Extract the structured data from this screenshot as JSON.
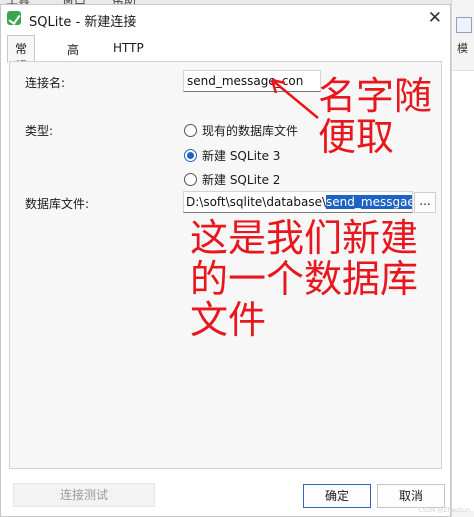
{
  "background_app": {
    "menu_items": [
      "工具",
      "窗口",
      "帮助"
    ],
    "right_panel_glyph": "模"
  },
  "dialog": {
    "title": "SQLite - 新建连接",
    "close_symbol": "✕",
    "tabs": [
      {
        "label": "常规",
        "active": true
      },
      {
        "label": "高级",
        "active": false
      },
      {
        "label": "HTTP",
        "active": false
      }
    ],
    "connection_name": {
      "label": "连接名:",
      "value": "send_message_con"
    },
    "type": {
      "label": "类型:",
      "options": [
        {
          "label": "现有的数据库文件",
          "checked": false
        },
        {
          "label": "新建 SQLite 3",
          "checked": true
        },
        {
          "label": "新建 SQLite 2",
          "checked": false
        }
      ]
    },
    "database_file": {
      "label": "数据库文件:",
      "path_prefix": "D:\\soft\\sqlite\\database\\",
      "selected_filename": "send_messgae.db",
      "browse_label": "..."
    },
    "buttons": {
      "test": "连接测试",
      "ok": "确定",
      "cancel": "取消"
    }
  },
  "annotations": {
    "note_name": "名字随便取",
    "note_file": "这是我们新建的一个数据库文件",
    "color": "#e8161d"
  },
  "watermark": "CSDN @ZhaoSun"
}
